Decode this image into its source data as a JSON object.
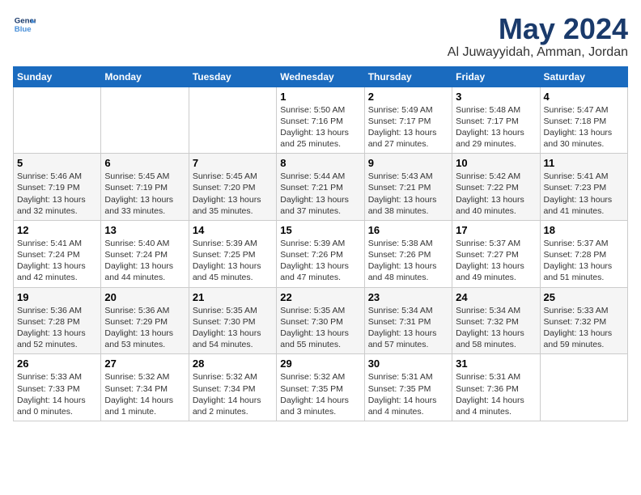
{
  "logo": {
    "line1": "General",
    "line2": "Blue"
  },
  "title": "May 2024",
  "location": "Al Juwayyidah, Amman, Jordan",
  "headers": [
    "Sunday",
    "Monday",
    "Tuesday",
    "Wednesday",
    "Thursday",
    "Friday",
    "Saturday"
  ],
  "weeks": [
    [
      {
        "day": "",
        "info": ""
      },
      {
        "day": "",
        "info": ""
      },
      {
        "day": "",
        "info": ""
      },
      {
        "day": "1",
        "info": "Sunrise: 5:50 AM\nSunset: 7:16 PM\nDaylight: 13 hours\nand 25 minutes."
      },
      {
        "day": "2",
        "info": "Sunrise: 5:49 AM\nSunset: 7:17 PM\nDaylight: 13 hours\nand 27 minutes."
      },
      {
        "day": "3",
        "info": "Sunrise: 5:48 AM\nSunset: 7:17 PM\nDaylight: 13 hours\nand 29 minutes."
      },
      {
        "day": "4",
        "info": "Sunrise: 5:47 AM\nSunset: 7:18 PM\nDaylight: 13 hours\nand 30 minutes."
      }
    ],
    [
      {
        "day": "5",
        "info": "Sunrise: 5:46 AM\nSunset: 7:19 PM\nDaylight: 13 hours\nand 32 minutes."
      },
      {
        "day": "6",
        "info": "Sunrise: 5:45 AM\nSunset: 7:19 PM\nDaylight: 13 hours\nand 33 minutes."
      },
      {
        "day": "7",
        "info": "Sunrise: 5:45 AM\nSunset: 7:20 PM\nDaylight: 13 hours\nand 35 minutes."
      },
      {
        "day": "8",
        "info": "Sunrise: 5:44 AM\nSunset: 7:21 PM\nDaylight: 13 hours\nand 37 minutes."
      },
      {
        "day": "9",
        "info": "Sunrise: 5:43 AM\nSunset: 7:21 PM\nDaylight: 13 hours\nand 38 minutes."
      },
      {
        "day": "10",
        "info": "Sunrise: 5:42 AM\nSunset: 7:22 PM\nDaylight: 13 hours\nand 40 minutes."
      },
      {
        "day": "11",
        "info": "Sunrise: 5:41 AM\nSunset: 7:23 PM\nDaylight: 13 hours\nand 41 minutes."
      }
    ],
    [
      {
        "day": "12",
        "info": "Sunrise: 5:41 AM\nSunset: 7:24 PM\nDaylight: 13 hours\nand 42 minutes."
      },
      {
        "day": "13",
        "info": "Sunrise: 5:40 AM\nSunset: 7:24 PM\nDaylight: 13 hours\nand 44 minutes."
      },
      {
        "day": "14",
        "info": "Sunrise: 5:39 AM\nSunset: 7:25 PM\nDaylight: 13 hours\nand 45 minutes."
      },
      {
        "day": "15",
        "info": "Sunrise: 5:39 AM\nSunset: 7:26 PM\nDaylight: 13 hours\nand 47 minutes."
      },
      {
        "day": "16",
        "info": "Sunrise: 5:38 AM\nSunset: 7:26 PM\nDaylight: 13 hours\nand 48 minutes."
      },
      {
        "day": "17",
        "info": "Sunrise: 5:37 AM\nSunset: 7:27 PM\nDaylight: 13 hours\nand 49 minutes."
      },
      {
        "day": "18",
        "info": "Sunrise: 5:37 AM\nSunset: 7:28 PM\nDaylight: 13 hours\nand 51 minutes."
      }
    ],
    [
      {
        "day": "19",
        "info": "Sunrise: 5:36 AM\nSunset: 7:28 PM\nDaylight: 13 hours\nand 52 minutes."
      },
      {
        "day": "20",
        "info": "Sunrise: 5:36 AM\nSunset: 7:29 PM\nDaylight: 13 hours\nand 53 minutes."
      },
      {
        "day": "21",
        "info": "Sunrise: 5:35 AM\nSunset: 7:30 PM\nDaylight: 13 hours\nand 54 minutes."
      },
      {
        "day": "22",
        "info": "Sunrise: 5:35 AM\nSunset: 7:30 PM\nDaylight: 13 hours\nand 55 minutes."
      },
      {
        "day": "23",
        "info": "Sunrise: 5:34 AM\nSunset: 7:31 PM\nDaylight: 13 hours\nand 57 minutes."
      },
      {
        "day": "24",
        "info": "Sunrise: 5:34 AM\nSunset: 7:32 PM\nDaylight: 13 hours\nand 58 minutes."
      },
      {
        "day": "25",
        "info": "Sunrise: 5:33 AM\nSunset: 7:32 PM\nDaylight: 13 hours\nand 59 minutes."
      }
    ],
    [
      {
        "day": "26",
        "info": "Sunrise: 5:33 AM\nSunset: 7:33 PM\nDaylight: 14 hours\nand 0 minutes."
      },
      {
        "day": "27",
        "info": "Sunrise: 5:32 AM\nSunset: 7:34 PM\nDaylight: 14 hours\nand 1 minute."
      },
      {
        "day": "28",
        "info": "Sunrise: 5:32 AM\nSunset: 7:34 PM\nDaylight: 14 hours\nand 2 minutes."
      },
      {
        "day": "29",
        "info": "Sunrise: 5:32 AM\nSunset: 7:35 PM\nDaylight: 14 hours\nand 3 minutes."
      },
      {
        "day": "30",
        "info": "Sunrise: 5:31 AM\nSunset: 7:35 PM\nDaylight: 14 hours\nand 4 minutes."
      },
      {
        "day": "31",
        "info": "Sunrise: 5:31 AM\nSunset: 7:36 PM\nDaylight: 14 hours\nand 4 minutes."
      },
      {
        "day": "",
        "info": ""
      }
    ]
  ]
}
